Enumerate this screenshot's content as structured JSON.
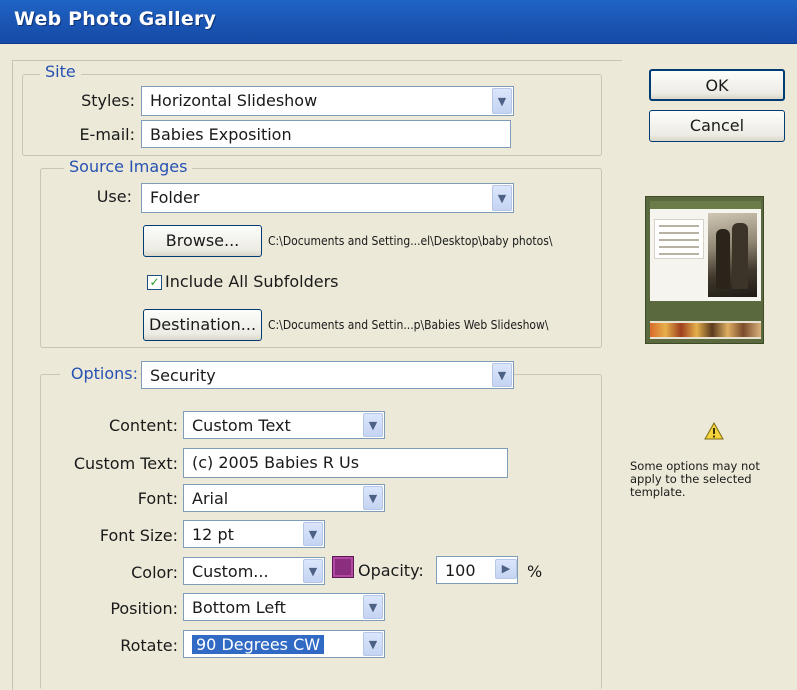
{
  "window": {
    "title": "Web Photo Gallery"
  },
  "buttons": {
    "ok": "OK",
    "cancel": "Cancel"
  },
  "site": {
    "legend": "Site",
    "styles_label": "Styles:",
    "styles_value": "Horizontal Slideshow",
    "email_label": "E-mail:",
    "email_value": "Babies Exposition"
  },
  "source": {
    "legend": "Source Images",
    "use_label": "Use:",
    "use_value": "Folder",
    "browse_label": "Browse...",
    "browse_path": "C:\\Documents and Setting...el\\Desktop\\baby photos\\",
    "include_subfolders_label": "Include All Subfolders",
    "include_subfolders_checked": true,
    "destination_label": "Destination...",
    "destination_path": "C:\\Documents and Settin...p\\Babies Web Slideshow\\"
  },
  "options": {
    "legend": "Options:",
    "value": "Security",
    "content_label": "Content:",
    "content_value": "Custom Text",
    "custom_text_label": "Custom Text:",
    "custom_text_value": "(c) 2005 Babies R Us",
    "font_label": "Font:",
    "font_value": "Arial",
    "font_size_label": "Font Size:",
    "font_size_value": "12 pt",
    "color_label": "Color:",
    "color_value": "Custom...",
    "color_swatch": "#8b2e7e",
    "opacity_label": "Opacity:",
    "opacity_value": "100",
    "opacity_unit": "%",
    "position_label": "Position:",
    "position_value": "Bottom Left",
    "rotate_label": "Rotate:",
    "rotate_value": "90 Degrees CW"
  },
  "sidepanel": {
    "warning_icon": "warning-icon",
    "warning_text": "Some options may not apply to the selected template."
  }
}
